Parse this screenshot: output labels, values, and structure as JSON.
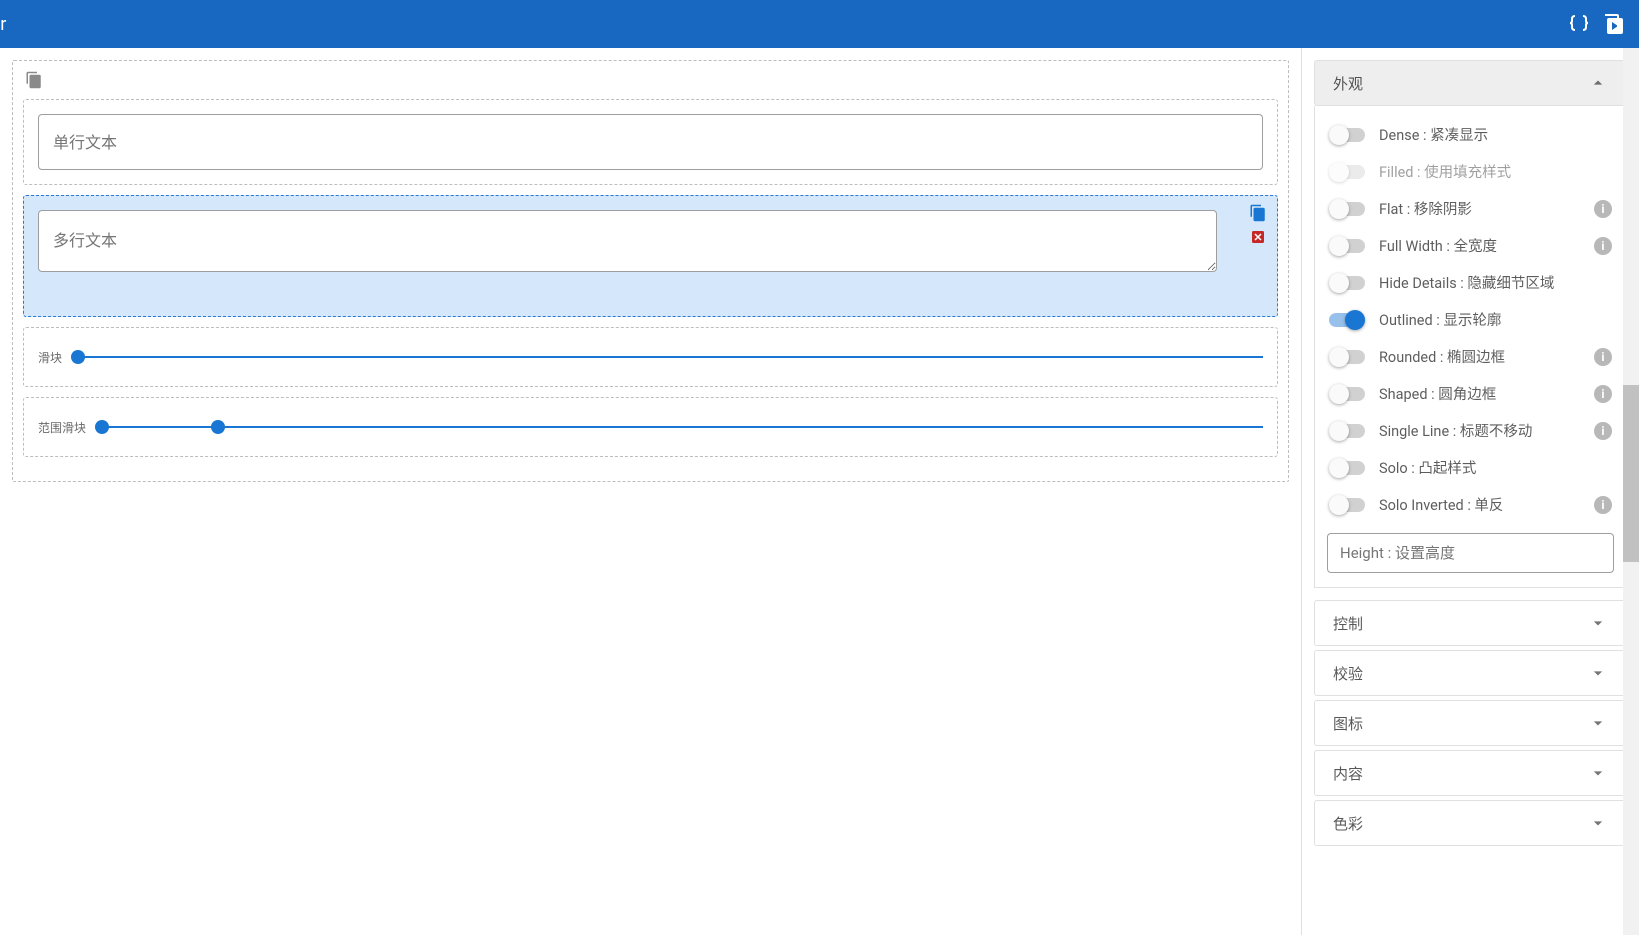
{
  "header": {
    "title_suffix": "or"
  },
  "canvas": {
    "blocks": [
      {
        "type": "textfield",
        "placeholder": "单行文本"
      },
      {
        "type": "textarea",
        "placeholder": "多行文本",
        "selected": true
      },
      {
        "type": "slider",
        "label": "滑块",
        "thumbs": [
          0
        ]
      },
      {
        "type": "range",
        "label": "范围滑块",
        "thumbs": [
          0,
          10
        ]
      }
    ]
  },
  "sidebar": {
    "appearance": {
      "title": "外观",
      "toggles": [
        {
          "label": "Dense : 紧凑显示",
          "on": false,
          "disabled": false,
          "info": false
        },
        {
          "label": "Filled : 使用填充样式",
          "on": false,
          "disabled": true,
          "info": false
        },
        {
          "label": "Flat : 移除阴影",
          "on": false,
          "disabled": false,
          "info": true
        },
        {
          "label": "Full Width : 全宽度",
          "on": false,
          "disabled": false,
          "info": true
        },
        {
          "label": "Hide Details : 隐藏细节区域",
          "on": false,
          "disabled": false,
          "info": false
        },
        {
          "label": "Outlined : 显示轮廓",
          "on": true,
          "disabled": false,
          "info": false
        },
        {
          "label": "Rounded : 椭圆边框",
          "on": false,
          "disabled": false,
          "info": true
        },
        {
          "label": "Shaped : 圆角边框",
          "on": false,
          "disabled": false,
          "info": true
        },
        {
          "label": "Single Line : 标题不移动",
          "on": false,
          "disabled": false,
          "info": true
        },
        {
          "label": "Solo : 凸起样式",
          "on": false,
          "disabled": false,
          "info": false
        },
        {
          "label": "Solo Inverted : 单反",
          "on": false,
          "disabled": false,
          "info": true
        }
      ],
      "height_placeholder": "Height : 设置高度"
    },
    "sections": [
      {
        "title": "控制"
      },
      {
        "title": "校验"
      },
      {
        "title": "图标"
      },
      {
        "title": "内容"
      },
      {
        "title": "色彩"
      }
    ]
  }
}
